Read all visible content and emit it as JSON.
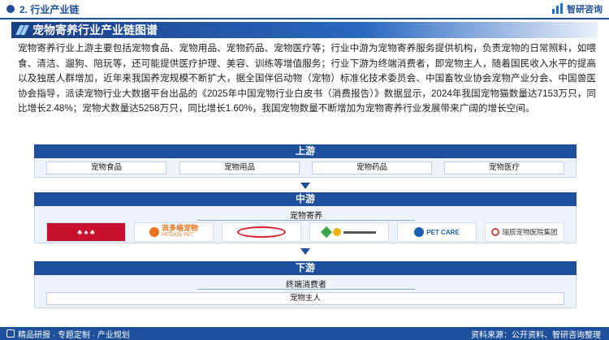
{
  "header": {
    "section_title": "2. 行业产业链",
    "brand_name": "智研咨询"
  },
  "banner": {
    "title": "宠物寄养行业产业链图谱"
  },
  "paragraph": "宠物寄养行业上游主要包括宠物食品、宠物用品、宠物药品、宠物医疗等；行业中游为宠物寄养服务提供机构，负责宠物的日常照料，如喂食、清洁、遛狗、陪玩等，还可能提供医疗护理、美容、训练等增值服务；行业下游为终端消费者，即宠物主人，随着国民收入水平的提高以及独居人群增加，近年来我国养宠规模不断扩大，据全国伴侣动物（宠物）标准化技术委员会、中国畜牧业协会宠物产业分会、中国兽医协会指导，派读宠物行业大数据平台出品的《2025年中国宠物行业白皮书（消费报告）》数据显示，2024年我国宠物猫数量达7153万只，同比增长2.48%；宠物犬数量达5258万只，同比增长1.60%，我国宠物数量不断增加为宠物寄养行业发展带来广阔的增长空间。",
  "upstream": {
    "label": "上游",
    "items": [
      "宠物食品",
      "宠物用品",
      "宠物药品",
      "宠物医疗"
    ]
  },
  "midstream": {
    "label": "中游",
    "sublabel": "宠物寄养",
    "logos": [
      {
        "name": "red-brand-logo",
        "text": "",
        "color": "#c8102e"
      },
      {
        "name": "petdog-logo",
        "text": "派多格宠物",
        "sub": "PETDOG·PET",
        "color": "#e8721c"
      },
      {
        "name": "red-oval-logo",
        "text": "",
        "color": "#d81e2a"
      },
      {
        "name": "colorful-logo",
        "text": "",
        "color": "#3aa64a"
      },
      {
        "name": "petcare-logo",
        "text": "PET CARE",
        "sub": "",
        "color": "#1b5fb0"
      },
      {
        "name": "ruipeng-logo",
        "text": "瑞辰宠物医院集团",
        "color": "#333333"
      }
    ]
  },
  "downstream": {
    "label": "下游",
    "sublabel": "终端消费者",
    "item": "宠物主人"
  },
  "footer": {
    "left": "精品研报 · 专题定制 · 产业规划",
    "source": "资料来源：公开资料、智研咨询整理"
  },
  "colors": {
    "primary": "#1d4f9a",
    "panel": "#eef3fa"
  }
}
